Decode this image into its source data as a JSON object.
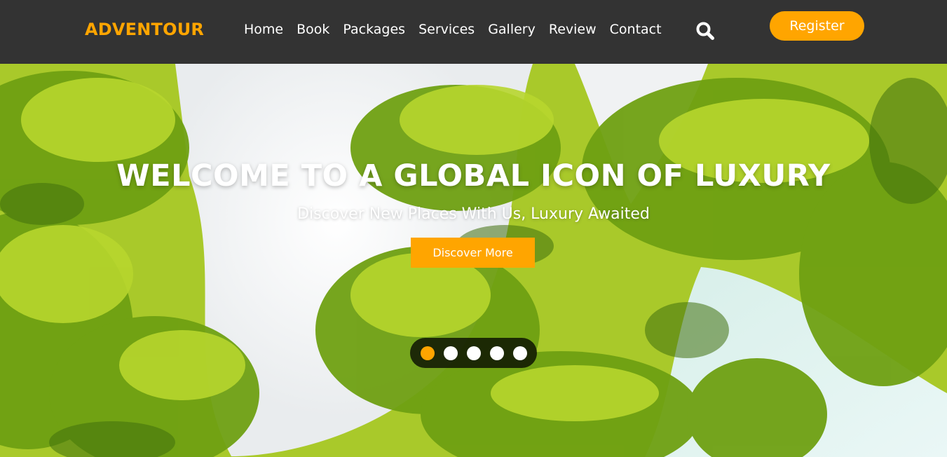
{
  "brand": {
    "name": "ADVENTOUR"
  },
  "nav": {
    "links": [
      "Home",
      "Book",
      "Packages",
      "Services",
      "Gallery",
      "Review",
      "Contact"
    ],
    "search_icon": "search-icon",
    "register_label": "Register"
  },
  "hero": {
    "title": "WELCOME TO A GLOBAL ICON OF LUXURY",
    "subtitle": "Discover New Places With Us, Luxury Awaited",
    "cta_label": "Discover More",
    "slides": {
      "count": 5,
      "active_index": 0
    }
  },
  "colors": {
    "accent": "#ffa500",
    "navbar_bg": "#333333",
    "text_light": "#ffffff",
    "palm_green": "#9bc41a",
    "sand": "#f2f4f3"
  }
}
